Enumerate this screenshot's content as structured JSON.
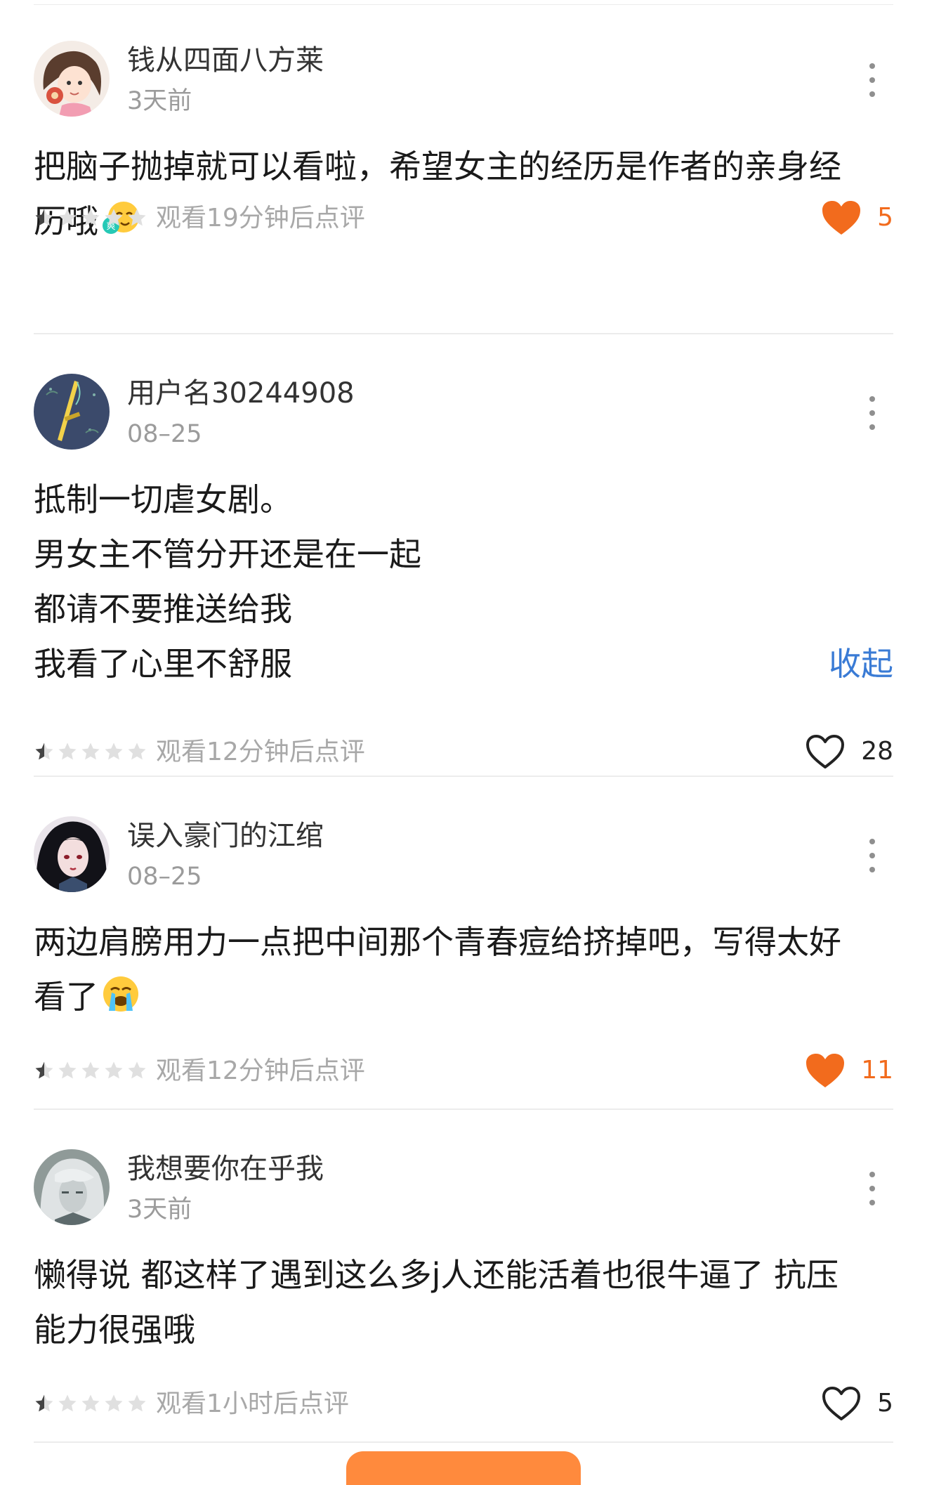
{
  "comments": [
    {
      "username": "钱从四面八方莱",
      "time": "3天前",
      "text_lines": [
        "把脑子抛掉就可以看啦，希望女主的经历是作者的亲身经",
        "历哦"
      ],
      "emoji": "shuang-emoji",
      "emoji_label": "爽",
      "watch_text": "观看19分钟后点评",
      "rating_stars": 1,
      "likes": "5",
      "liked": true,
      "avatar": "cartoon-girl-avatar"
    },
    {
      "username": "用户名30244908",
      "time": "08–25",
      "text_lines": [
        "抵制一切虐女剧。",
        "男女主不管分开还是在一起",
        "都请不要推送给我",
        "我看了心里不舒服"
      ],
      "collapse_label": "收起",
      "watch_text": "观看12分钟后点评",
      "rating_stars": 1,
      "likes": "28",
      "liked": false,
      "avatar": "sword-avatar"
    },
    {
      "username": "误入豪门的江绾",
      "time": "08–25",
      "text_lines": [
        "两边肩膀用力一点把中间那个青春痘给挤掉吧，写得太好",
        "看了"
      ],
      "emoji": "crying-emoji",
      "watch_text": "观看12分钟后点评",
      "rating_stars": 1,
      "likes": "11",
      "liked": true,
      "avatar": "dark-hair-girl-avatar"
    },
    {
      "username": "我想要你在乎我",
      "time": "3天前",
      "text_lines": [
        "懒得说 都这样了遇到这么多j人还能活着也很牛逼了 抗压",
        "能力很强哦"
      ],
      "watch_text": "观看1小时后点评",
      "rating_stars": 1,
      "likes": "5",
      "liked": false,
      "avatar": "silver-hair-avatar"
    }
  ],
  "colors": {
    "accent_orange": "#f26b1d",
    "link_blue": "#3a7bd5",
    "meta_gray": "#9b9b9b"
  }
}
